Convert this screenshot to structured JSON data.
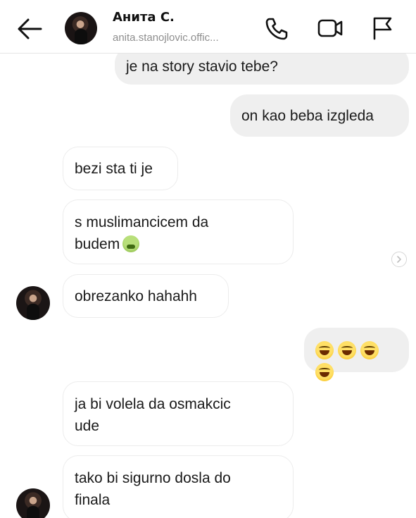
{
  "header": {
    "name": "Анита С.",
    "username": "anita.stanojlovic.offic..."
  },
  "icons": {
    "back": "arrow-left-icon",
    "call": "phone-icon",
    "video": "video-camera-icon",
    "report": "flag-icon"
  },
  "messages": [
    {
      "direction": "outgoing",
      "text": "je na  story stavio tebe?"
    },
    {
      "direction": "outgoing",
      "text": "on kao beba izgleda"
    },
    {
      "direction": "incoming",
      "text": "bezi sta ti je"
    },
    {
      "direction": "incoming",
      "lines": [
        "s muslimancicem da",
        "budem"
      ],
      "emoji": "nauseated-face"
    },
    {
      "direction": "incoming",
      "text": "obrezanko hahahh"
    },
    {
      "direction": "outgoing",
      "emoji": "grinning-squinting-face",
      "emoji_count": 4
    },
    {
      "direction": "incoming",
      "lines": [
        "ja bi volela da osmakcic",
        "ude"
      ]
    },
    {
      "direction": "incoming",
      "lines": [
        "tako bi sigurno dosla do",
        "finala"
      ]
    }
  ]
}
